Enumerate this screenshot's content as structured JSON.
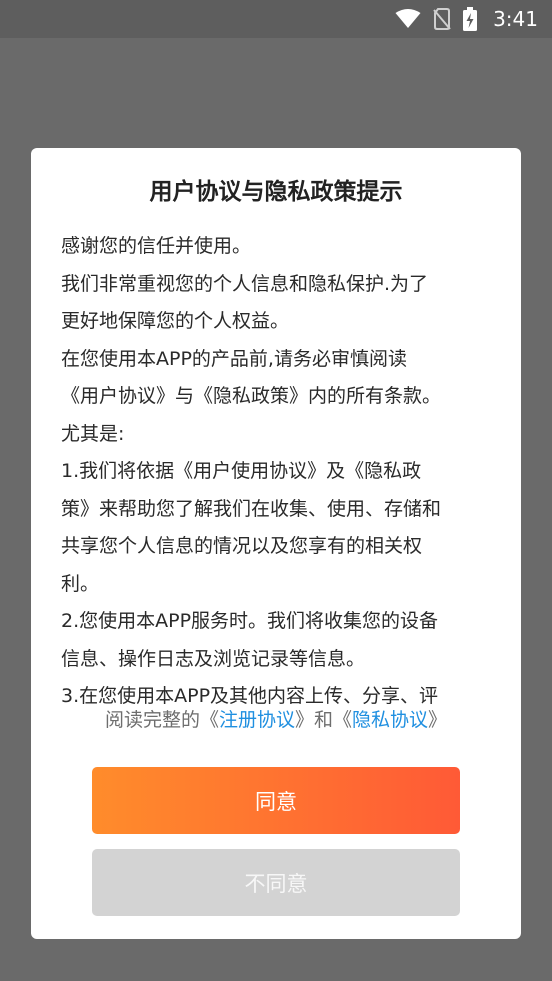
{
  "status_bar": {
    "time": "3:41",
    "icons": [
      "wifi-icon",
      "no-sim-icon",
      "battery-charging-icon"
    ]
  },
  "dialog": {
    "title": "用户协议与隐私政策提示",
    "content_lines": [
      "感谢您的信任并使用。",
      "我们非常重视您的个人信息和隐私保护.为了",
      "更好地保障您的个人权益。",
      "在您使用本APP的产品前,请务必审慎阅读",
      "《用户协议》与《隐私政策》内的所有条款。",
      "尤其是:",
      "1.我们将依据《用户使用协议》及《隐私政",
      "策》来帮助您了解我们在收集、使用、存储和",
      "共享您个人信息的情况以及您享有的相关权",
      "利。",
      " 2.您使用本APP服务时。我们将收集您的设备",
      "信息、操作日志及浏览记录等信息。",
      "3.在您使用本APP及其他内容上传、分享、评"
    ],
    "agreement": {
      "prefix": "阅读完整的《",
      "register_link": "注册协议",
      "middle": "》和《",
      "privacy_link": "隐私协议",
      "suffix": "》"
    },
    "agree_label": "同意",
    "disagree_label": "不同意"
  },
  "colors": {
    "link": "#1f8fe0",
    "agree_gradient_start": "#ff8c2b",
    "agree_gradient_end": "#ff5a36",
    "disagree_bg": "#d3d3d3",
    "overlay": "#6a6a6a"
  }
}
